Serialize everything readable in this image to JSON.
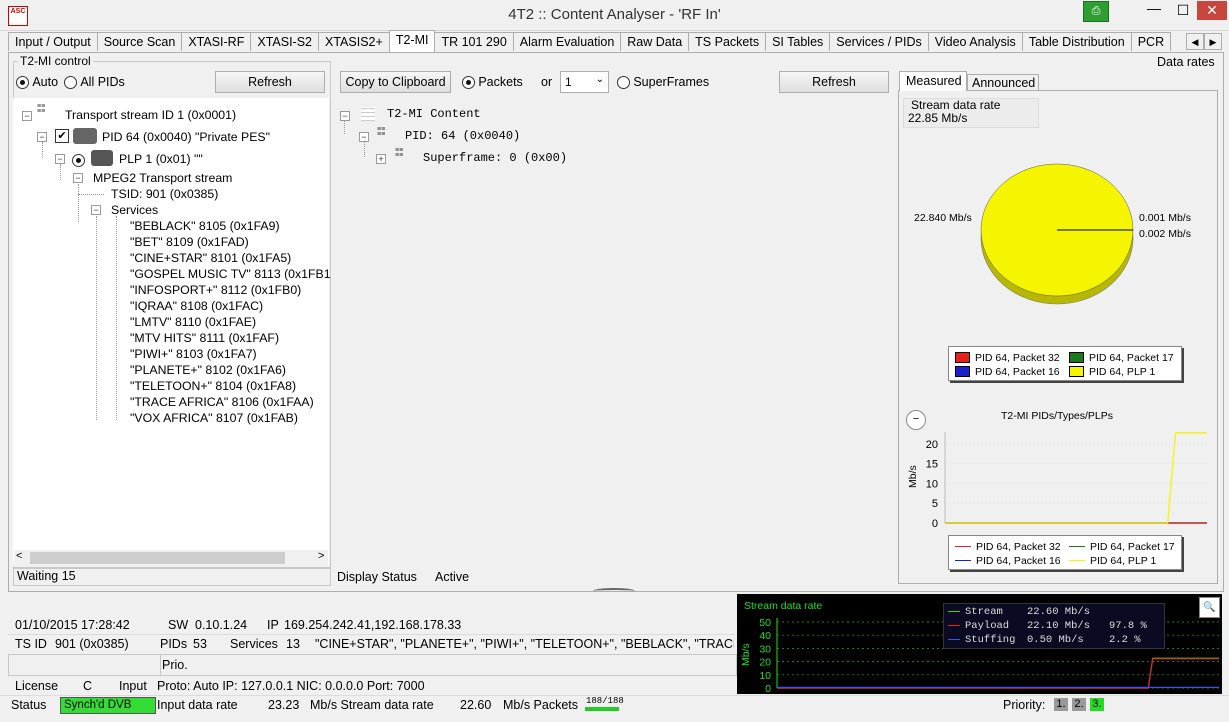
{
  "window": {
    "app_icon_text": "ASC",
    "title": "4T2 :: Content Analyser - 'RF In'",
    "pin_glyph": "⎙",
    "min_glyph": "—",
    "max_glyph": "☐",
    "close_glyph": "✕"
  },
  "tabs": [
    "Input / Output",
    "Source Scan",
    "XTASI-RF",
    "XTASI-S2",
    "XTASIS2+",
    "T2-MI",
    "TR 101 290",
    "Alarm Evaluation",
    "Raw Data",
    "TS Packets",
    "SI Tables",
    "Services / PIDs",
    "Video Analysis",
    "Table Distribution",
    "PCR"
  ],
  "active_tab": "T2-MI",
  "tab_scroll": {
    "left": "◀",
    "right": "▶"
  },
  "left_panel": {
    "group_title": "T2-MI control",
    "radio_auto": "Auto",
    "radio_all": "All PIDs",
    "refresh": "Refresh",
    "tree": {
      "ts": "Transport stream ID 1 (0x0001)",
      "pid": "PID 64 (0x0040) \"Private PES\"",
      "plp": "PLP 1 (0x01) \"\"",
      "mpeg": "MPEG2 Transport stream",
      "tsid": "TSID: 901 (0x0385)",
      "services_label": "Services",
      "services": [
        "\"BEBLACK\" 8105 (0x1FA9)",
        "\"BET\" 8109 (0x1FAD)",
        "\"CINE+STAR\" 8101 (0x1FA5)",
        "\"GOSPEL MUSIC TV\" 8113 (0x1FB1",
        "\"INFOSPORT+\" 8112 (0x1FB0)",
        "\"IQRAA\" 8108 (0x1FAC)",
        "\"LMTV\" 8110 (0x1FAE)",
        "\"MTV HITS\" 8111 (0x1FAF)",
        "\"PIWI+\" 8103 (0x1FA7)",
        "\"PLANETE+\" 8102 (0x1FA6)",
        "\"TELETOON+\" 8104 (0x1FA8)",
        "\"TRACE AFRICA\" 8106 (0x1FAA)",
        "\"VOX AFRICA\" 8107 (0x1FAB)"
      ]
    },
    "hscroll_left": "<",
    "hscroll_right": ">",
    "status": "Waiting 15"
  },
  "middle_panel": {
    "copy_btn": "Copy to Clipboard",
    "radio_packets": "Packets",
    "or_label": "or",
    "select_value": "1",
    "radio_superframes": "SuperFrames",
    "refresh": "Refresh",
    "tree": {
      "root": "T2-MI Content",
      "pid": "PID: 64 (0x0040)",
      "superframe": "Superframe: 0 (0x00)"
    },
    "display_status_label": "Display Status",
    "display_status_value": "Active"
  },
  "right_panel": {
    "header": "Data rates",
    "tab_measured": "Measured",
    "tab_announced": "Announced",
    "stream_rate_label": "Stream data rate",
    "stream_rate_value": "22.85 Mb/s",
    "pie_label_left": "22.840 Mb/s",
    "pie_label_right1": "0.001 Mb/s",
    "pie_label_right2": "0.002 Mb/s",
    "chart_title": "T2-MI PIDs/Types/PLPs",
    "y_axis_label": "Mb/s",
    "y_ticks": [
      "20",
      "15",
      "10",
      "5",
      "0"
    ],
    "legend": [
      {
        "label": "PID 64, Packet 32",
        "color": "#e8201c"
      },
      {
        "label": "PID 64, Packet 17",
        "color": "#1a7a1a"
      },
      {
        "label": "PID 64, Packet 16",
        "color": "#1a22d0"
      },
      {
        "label": "PID 64, PLP 1",
        "color": "#f5f500"
      }
    ]
  },
  "chart_data": [
    {
      "type": "pie",
      "categories": [
        "PID 64, PLP 1",
        "PID 64, Packet 32",
        "PID 64, Packet 16",
        "PID 64, Packet 17"
      ],
      "values": [
        22.84,
        0.001,
        0.002,
        0.001
      ],
      "colors": [
        "#f5f500",
        "#e8201c",
        "#1a22d0",
        "#1a7a1a"
      ],
      "units": "Mb/s"
    },
    {
      "type": "line",
      "title": "T2-MI PIDs/Types/PLPs",
      "ylabel": "Mb/s",
      "ylim": [
        0,
        23
      ],
      "yticks": [
        0,
        5,
        10,
        15,
        20
      ],
      "series": [
        {
          "name": "PID 64, PLP 1",
          "color": "#f5f500",
          "x": [
            0,
            85,
            88,
            100
          ],
          "y": [
            0,
            0,
            22.8,
            22.8
          ]
        },
        {
          "name": "PID 64, Packet 32",
          "color": "#e8201c",
          "x": [
            0,
            100
          ],
          "y": [
            0,
            0
          ]
        },
        {
          "name": "PID 64, Packet 17",
          "color": "#1a7a1a",
          "x": [
            0,
            100
          ],
          "y": [
            0,
            0
          ]
        },
        {
          "name": "PID 64, Packet 16",
          "color": "#1a22d0",
          "x": [
            0,
            100
          ],
          "y": [
            0,
            0
          ]
        }
      ]
    },
    {
      "type": "line",
      "title": "Stream data rate",
      "ylabel": "Mb/s",
      "ylim": [
        0,
        50
      ],
      "yticks": [
        0,
        10,
        20,
        30,
        40,
        50
      ],
      "series": [
        {
          "name": "Stream",
          "color": "#22cc22",
          "x": [
            0,
            84,
            85,
            100
          ],
          "y": [
            0,
            0,
            22.6,
            22.6
          ]
        },
        {
          "name": "Payload",
          "color": "#e8201c",
          "x": [
            0,
            84,
            85,
            100
          ],
          "y": [
            0,
            0,
            22.1,
            22.1
          ]
        },
        {
          "name": "Stuffing",
          "color": "#3355ff",
          "x": [
            0,
            100
          ],
          "y": [
            0.5,
            0.5
          ]
        }
      ]
    }
  ],
  "bottom": {
    "datetime": "01/10/2015 17:28:42",
    "sw_label": "SW",
    "sw_value": "0.10.1.24",
    "ip_label": "IP",
    "ip_value": "169.254.242.41,192.168.178.33",
    "tsid_label": "TS ID",
    "tsid_value": "901 (0x0385)",
    "pids_label": "PIDs",
    "pids_value": "53",
    "services_label": "Services",
    "services_value": "13",
    "services_list": "\"CINE+STAR\", \"PLANETE+\", \"PIWI+\", \"TELETOON+\", \"BEBLACK\", \"TRACE",
    "prio_label": "Prio.",
    "license_label": "License",
    "license_value": "C",
    "input_label": "Input",
    "input_value": "Proto: Auto IP: 127.0.0.1 NIC: 0.0.0.0 Port: 7000",
    "status_label": "Status",
    "status_value": "Synch'd DVB",
    "input_rate_label": "Input data rate",
    "input_rate_value": "23.23",
    "stream_rate_label": "Mb/s Stream data rate",
    "stream_rate_value": "22.60",
    "packets_label": "Mb/s Packets",
    "packets_value": "188/188",
    "priority_label": "Priority:",
    "priority_boxes": [
      "1.",
      "2.",
      "3."
    ]
  },
  "stream_chart": {
    "title": "Stream data rate",
    "y_label": "Mb/s",
    "y_ticks": [
      "50",
      "40",
      "30",
      "20",
      "10",
      "0"
    ],
    "legend": [
      {
        "name": "Stream",
        "value": "22.60 Mb/s",
        "pct": ""
      },
      {
        "name": "Payload",
        "value": "22.10 Mb/s",
        "pct": "97.8 %"
      },
      {
        "name": "Stuffing",
        "value": "0.50 Mb/s",
        "pct": "2.2 %"
      }
    ]
  }
}
